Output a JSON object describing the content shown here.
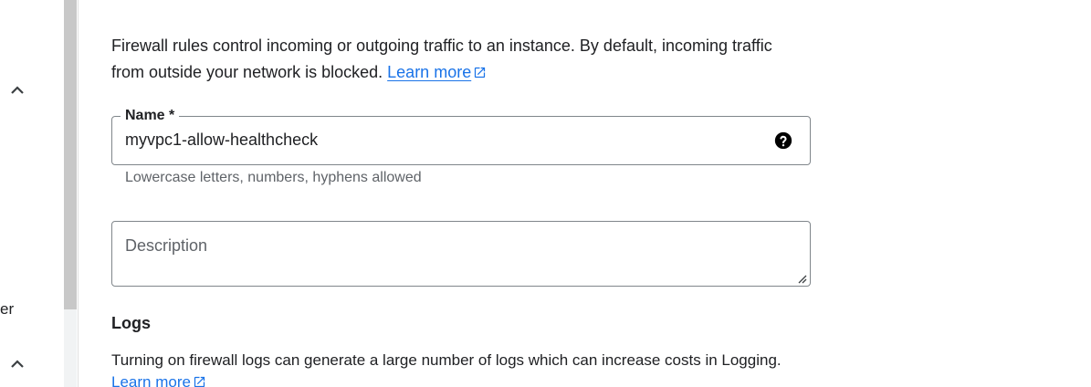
{
  "sidebar": {
    "item_fragment": "er"
  },
  "firewall": {
    "intro_text": "Firewall rules control incoming or outgoing traffic to an instance. By default, incoming traffic from outside your network is blocked.",
    "learn_more": "Learn more"
  },
  "name_field": {
    "label": "Name *",
    "value": "myvpc1-allow-healthcheck",
    "hint": "Lowercase letters, numbers, hyphens allowed"
  },
  "description_field": {
    "placeholder": "Description"
  },
  "logs": {
    "title": "Logs",
    "text": " Turning on firewall logs can generate a large number of logs which can increase costs in Logging.",
    "learn_more": "Learn more"
  },
  "colors": {
    "link": "#1a73e8",
    "text": "#202124",
    "secondary_text": "#5f6368",
    "border": "#80868b"
  },
  "icons": [
    "chevron-up-icon",
    "external-link-icon",
    "help-icon",
    "resize-handle-icon"
  ]
}
